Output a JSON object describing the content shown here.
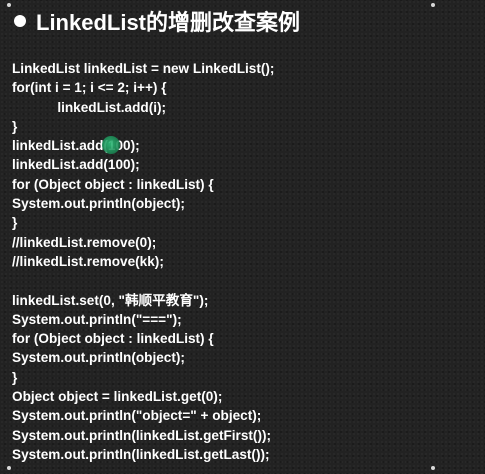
{
  "title": "LinkedList的增删改查案例",
  "code_lines": [
    "LinkedList linkedList = new LinkedList();",
    "for(int i = 1; i <= 2; i++) {",
    "            linkedList.add(i);",
    "}",
    "linkedList.add(100);",
    "linkedList.add(100);",
    "for (Object object : linkedList) {",
    "System.out.println(object);",
    "}",
    "//linkedList.remove(0);",
    "//linkedList.remove(kk);",
    "",
    "linkedList.set(0, \"韩顺平教育\");",
    "System.out.println(\"===\");",
    "for (Object object : linkedList) {",
    "System.out.println(object);",
    "}",
    "Object object = linkedList.get(0);",
    "System.out.println(\"object=\" + object);",
    "System.out.println(linkedList.getFirst());",
    "System.out.println(linkedList.getLast());"
  ]
}
